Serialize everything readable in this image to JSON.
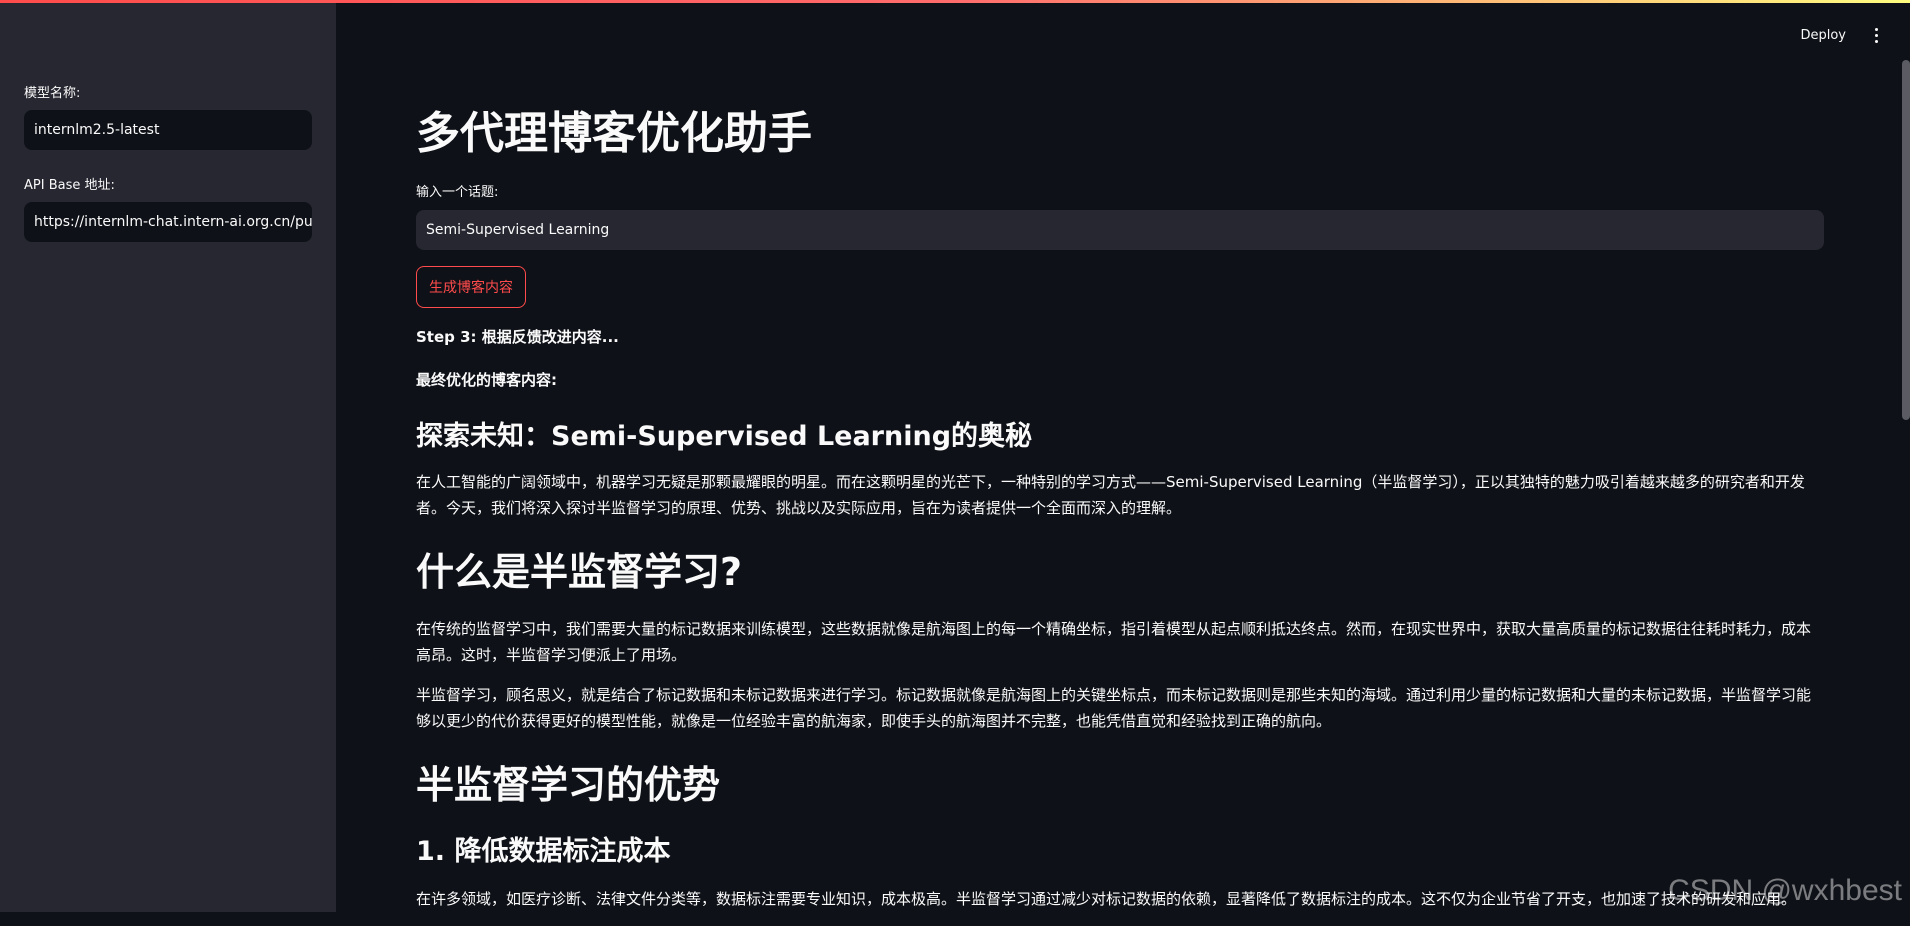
{
  "sidebar": {
    "model_label": "模型名称:",
    "model_value": "internlm2.5-latest",
    "api_label": "API Base 地址:",
    "api_value": "https://internlm-chat.intern-ai.org.cn/pu"
  },
  "header": {
    "deploy_label": "Deploy"
  },
  "main": {
    "title": "多代理博客优化助手",
    "topic_label": "输入一个话题:",
    "topic_value": "Semi-Supervised Learning",
    "generate_button": "生成博客内容",
    "step_text": "Step 3: 根据反馈改进内容...",
    "final_label": "最终优化的博客内容:",
    "sections": [
      {
        "heading": "探索未知：Semi-Supervised Learning的奥秘",
        "paragraphs": [
          "在人工智能的广阔领域中，机器学习无疑是那颗最耀眼的明星。而在这颗明星的光芒下，一种特别的学习方式——Semi-Supervised Learning（半监督学习），正以其独特的魅力吸引着越来越多的研究者和开发者。今天，我们将深入探讨半监督学习的原理、优势、挑战以及实际应用，旨在为读者提供一个全面而深入的理解。"
        ]
      },
      {
        "heading": "什么是半监督学习?",
        "paragraphs": [
          "在传统的监督学习中，我们需要大量的标记数据来训练模型，这些数据就像是航海图上的每一个精确坐标，指引着模型从起点顺利抵达终点。然而，在现实世界中，获取大量高质量的标记数据往往耗时耗力，成本高昂。这时，半监督学习便派上了用场。",
          "半监督学习，顾名思义，就是结合了标记数据和未标记数据来进行学习。标记数据就像是航海图上的关键坐标点，而未标记数据则是那些未知的海域。通过利用少量的标记数据和大量的未标记数据，半监督学习能够以更少的代价获得更好的模型性能，就像是一位经验丰富的航海家，即使手头的航海图并不完整，也能凭借直觉和经验找到正确的航向。"
        ]
      },
      {
        "heading": "半监督学习的优势",
        "paragraphs": []
      },
      {
        "heading": "1. 降低数据标注成本",
        "paragraphs": [
          "在许多领域，如医疗诊断、法律文件分类等，数据标注需要专业知识，成本极高。半监督学习通过减少对标记数据的依赖，显著降低了数据标注的成本。这不仅为企业节省了开支，也加速了技术的研发和应用。"
        ]
      }
    ]
  },
  "watermark": "CSDN @wxhbest"
}
